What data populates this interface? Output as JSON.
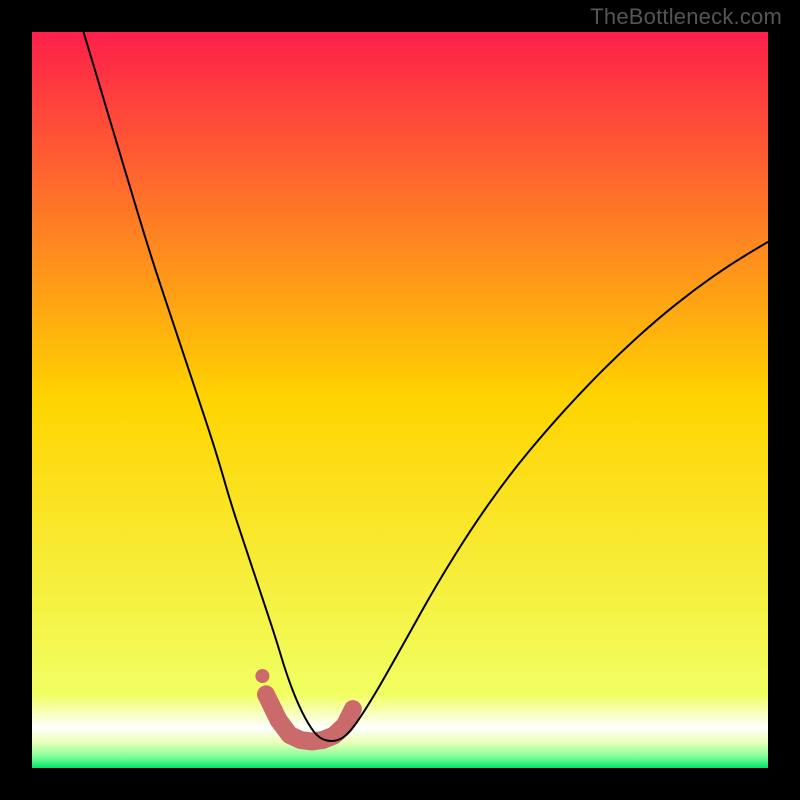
{
  "watermark": "TheBottleneck.com",
  "chart_data": {
    "type": "line",
    "title": "",
    "xlabel": "",
    "ylabel": "",
    "xlim": [
      0,
      100
    ],
    "ylim": [
      0,
      100
    ],
    "grid": false,
    "legend": false,
    "background_gradient": {
      "stops": [
        {
          "pos": 0.0,
          "color": "#ff1f4b"
        },
        {
          "pos": 0.5,
          "color": "#ffd400"
        },
        {
          "pos": 0.9,
          "color": "#f1ff62"
        },
        {
          "pos": 0.945,
          "color": "#ffffff"
        },
        {
          "pos": 0.965,
          "color": "#ebffb8"
        },
        {
          "pos": 0.985,
          "color": "#7fff9a"
        },
        {
          "pos": 1.0,
          "color": "#00e46a"
        }
      ]
    },
    "series": [
      {
        "name": "bottleneck-curve",
        "stroke": "#000000",
        "stroke_width": 2,
        "x": [
          7,
          10,
          13,
          16,
          19,
          22,
          25,
          27,
          29,
          31,
          33,
          34.5,
          36,
          37.5,
          39,
          41,
          43,
          46,
          50,
          55,
          60,
          65,
          70,
          75,
          80,
          85,
          90,
          95,
          100
        ],
        "y": [
          100,
          90,
          80,
          70,
          61,
          52,
          43,
          36,
          30,
          24,
          18,
          13,
          9,
          6,
          4,
          3.5,
          4.5,
          9,
          16,
          25,
          33,
          40,
          46,
          51.5,
          56.5,
          61,
          65,
          68.5,
          71.5
        ]
      }
    ],
    "highlight": {
      "name": "optimal-region",
      "x": [
        31.8,
        33.5,
        35,
        36.5,
        38,
        39.5,
        41,
        42.5,
        43.6
      ],
      "y": [
        10,
        6.5,
        4.5,
        3.8,
        3.6,
        3.8,
        4.4,
        5.8,
        8
      ],
      "stroke": "#cb6a6a",
      "stroke_width": 18,
      "end_dot": {
        "x": 31.3,
        "y": 12.5,
        "r": 7
      }
    }
  }
}
